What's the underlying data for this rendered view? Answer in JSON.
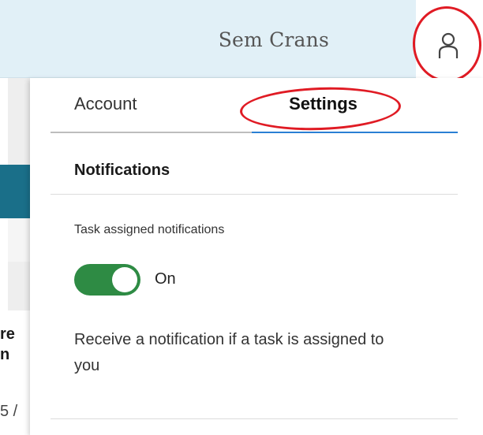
{
  "header": {
    "user_name": "Sem Crans",
    "avatar_icon": "user-icon",
    "background_color": "#e1f0f7"
  },
  "background_page": {
    "fragment_1": "re",
    "fragment_2": "n",
    "fragment_3": "5 /",
    "accent_color": "#1a6f89"
  },
  "panel": {
    "tabs": [
      {
        "label": "Account",
        "active": false
      },
      {
        "label": "Settings",
        "active": true
      }
    ],
    "section_title": "Notifications",
    "toggle": {
      "label": "Task assigned notifications",
      "state_text": "On",
      "checked": true,
      "on_color": "#2e8b44"
    },
    "description": "Receive a notification if a task is assigned to you"
  },
  "annotations": {
    "circle_color": "#e01b24"
  }
}
